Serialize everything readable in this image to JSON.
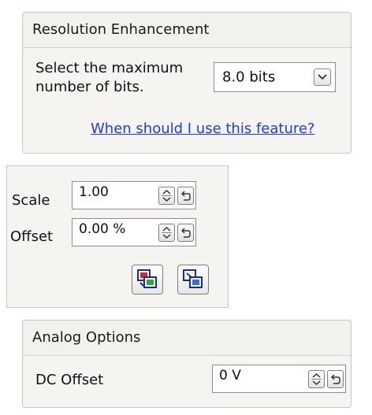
{
  "resolution_enhancement": {
    "title": "Resolution Enhancement",
    "prompt_line1": "Select the maximum",
    "prompt_line2": "number of bits.",
    "bits_value": "8.0 bits",
    "help_link": "When should I use this feature?"
  },
  "scale_offset": {
    "scale_label": "Scale",
    "scale_value": "1.00",
    "offset_label": "Offset",
    "offset_value": "0.00 %"
  },
  "analog_options": {
    "title": "Analog Options",
    "dc_offset_label": "DC Offset",
    "dc_offset_value": "0 V"
  },
  "icons": [
    "chevron-down-icon",
    "spin-updown-icon",
    "reset-icon",
    "copy-to-channels-icon",
    "paste-settings-icon"
  ],
  "colors": {
    "link": "#1a3cff",
    "panel_bg": "#f5f4f0",
    "border": "#c7c6c2"
  }
}
